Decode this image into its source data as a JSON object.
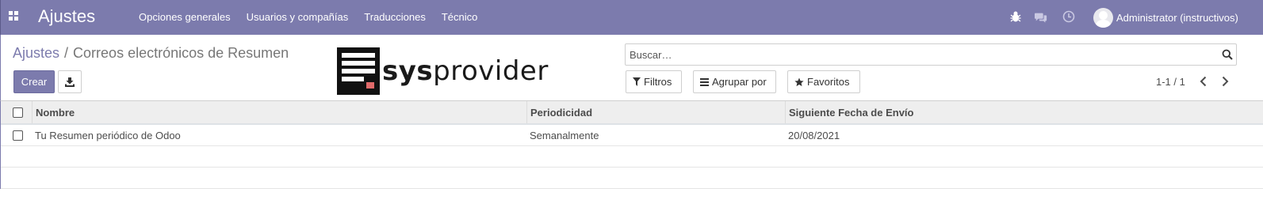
{
  "navbar": {
    "brand": "Ajustes",
    "menu": [
      "Opciones generales",
      "Usuarios y compañías",
      "Traducciones",
      "Técnico"
    ],
    "user_name": "Administrator (instructivos)",
    "icons": [
      "bug-icon",
      "chat-icon",
      "clock-icon"
    ]
  },
  "breadcrumb": {
    "parent": "Ajustes",
    "separator": "/",
    "current": "Correos electrónicos de Resumen"
  },
  "toolbar": {
    "create_label": "Crear"
  },
  "logo": {
    "text_bold": "sys",
    "text_regular": "provider"
  },
  "search": {
    "placeholder": "Buscar…"
  },
  "filters": {
    "filters_label": "Filtros",
    "group_label": "Agrupar por",
    "favorites_label": "Favoritos"
  },
  "pager": {
    "value": "1-1 / 1"
  },
  "table": {
    "columns": [
      "Nombre",
      "Periodicidad",
      "Siguiente Fecha de Envío"
    ],
    "rows": [
      [
        "Tu Resumen periódico de Odoo",
        "Semanalmente",
        "20/08/2021"
      ]
    ]
  },
  "colors": {
    "brand": "#7c7bad",
    "header_bg": "#eeeeee"
  }
}
